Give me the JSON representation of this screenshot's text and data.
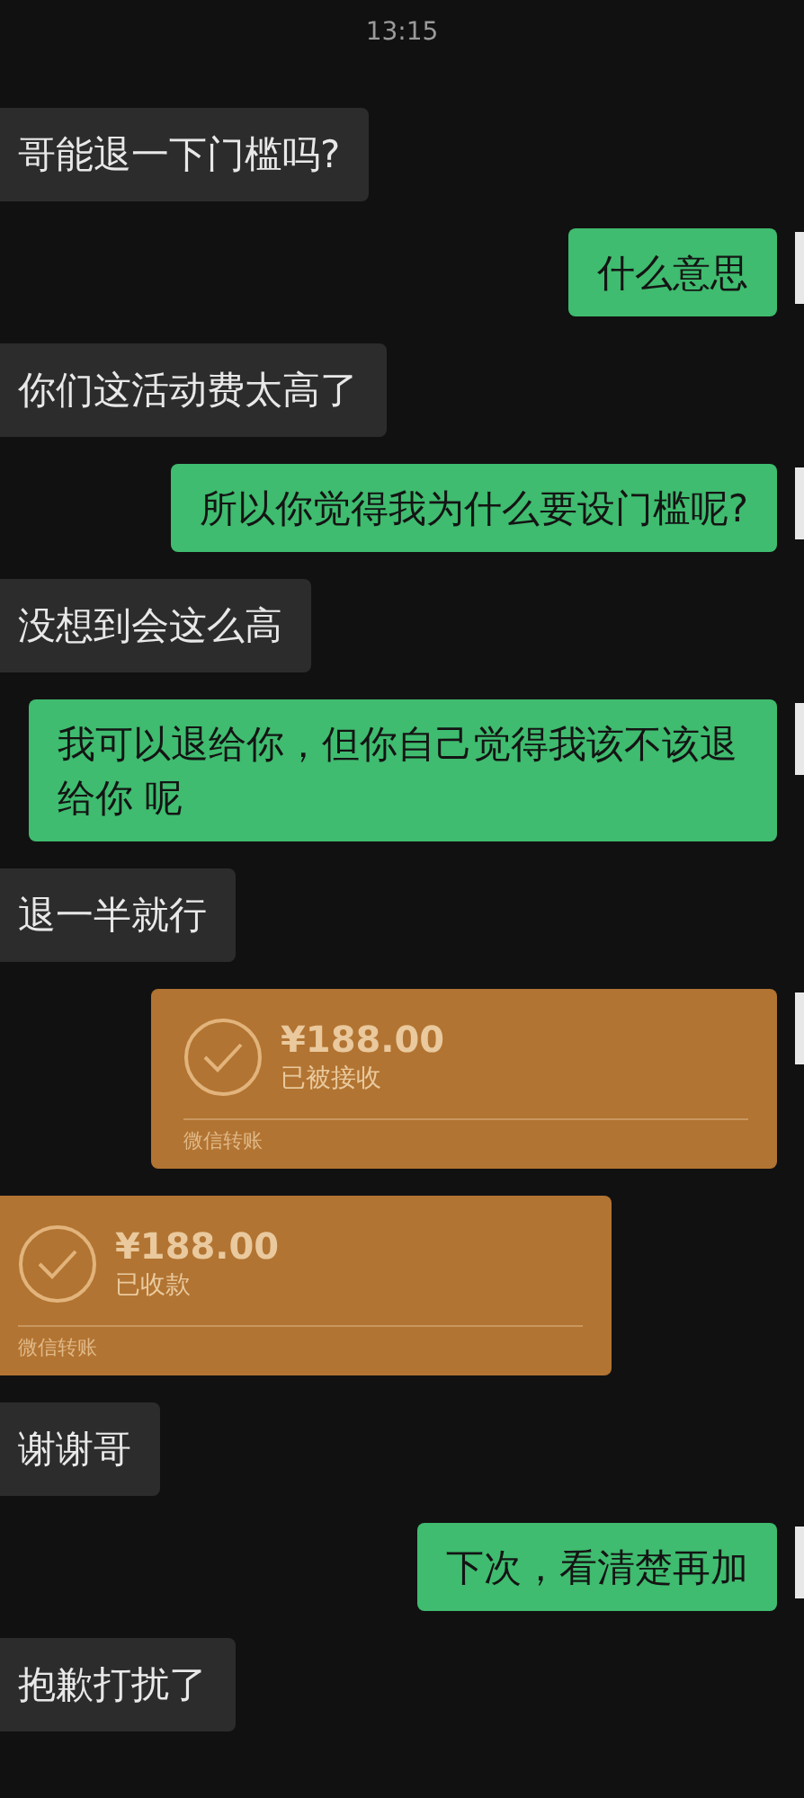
{
  "time": "13:15",
  "messages": [
    {
      "kind": "text",
      "from_me": false,
      "text": "哥能退一下门槛吗?"
    },
    {
      "kind": "text",
      "from_me": true,
      "text": "什么意思"
    },
    {
      "kind": "text",
      "from_me": false,
      "text": "你们这活动费太高了"
    },
    {
      "kind": "text",
      "from_me": true,
      "text": "所以你觉得我为什么要设门槛呢?"
    },
    {
      "kind": "text",
      "from_me": false,
      "text": "没想到会这么高"
    },
    {
      "kind": "text",
      "from_me": true,
      "text": "我可以退给你，但你自己觉得我该不该退给你 呢"
    },
    {
      "kind": "text",
      "from_me": false,
      "text": "退一半就行"
    },
    {
      "kind": "transfer",
      "from_me": true,
      "amount": "¥188.00",
      "status": "已被接收",
      "label": "微信转账"
    },
    {
      "kind": "transfer",
      "from_me": false,
      "amount": "¥188.00",
      "status": "已收款",
      "label": "微信转账"
    },
    {
      "kind": "text",
      "from_me": false,
      "text": "谢谢哥"
    },
    {
      "kind": "text",
      "from_me": true,
      "text": "下次，看清楚再加"
    },
    {
      "kind": "text",
      "from_me": false,
      "text": "抱歉打扰了"
    }
  ]
}
